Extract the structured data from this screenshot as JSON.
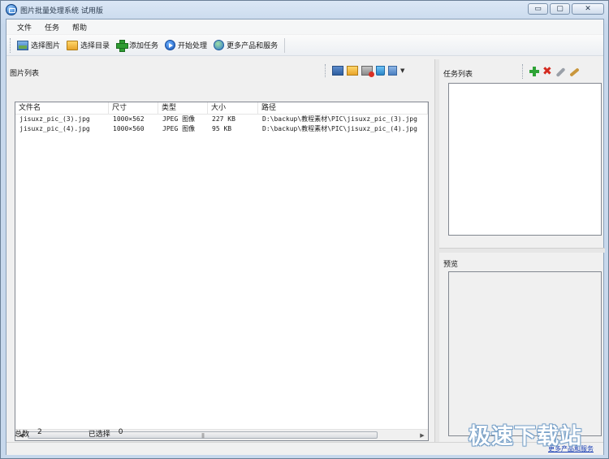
{
  "window": {
    "title": "图片批量处理系统 试用版",
    "controls": {
      "minimize": "▭",
      "restore": "▢",
      "close": "✕"
    }
  },
  "menu": [
    "文件",
    "任务",
    "帮助"
  ],
  "toolbar": {
    "select_images": "选择图片",
    "select_folder": "选择目录",
    "add_task": "添加任务",
    "start_process": "开始处理",
    "more_products": "更多产品和服务"
  },
  "image_list": {
    "title": "图片列表",
    "columns": [
      "文件名",
      "尺寸",
      "类型",
      "大小",
      "路径"
    ],
    "rows": [
      [
        "jisuxz_pic_(3).jpg",
        "1000×562",
        "JPEG 图像",
        "227 KB",
        "D:\\backup\\教程素材\\PIC\\jisuxz_pic_(3).jpg"
      ],
      [
        "jisuxz_pic_(4).jpg",
        "1000×560",
        "JPEG 图像",
        "95 KB",
        "D:\\backup\\教程素材\\PIC\\jisuxz_pic_(4).jpg"
      ]
    ]
  },
  "status": {
    "total_label": "总数",
    "total_value": "2",
    "selected_label": "已选择",
    "selected_value": "0"
  },
  "task_panel": {
    "title": "任务列表"
  },
  "preview_panel": {
    "title": "预览"
  },
  "footer": {
    "more_link": "更多产品和服务"
  },
  "watermark": "极速下载站"
}
